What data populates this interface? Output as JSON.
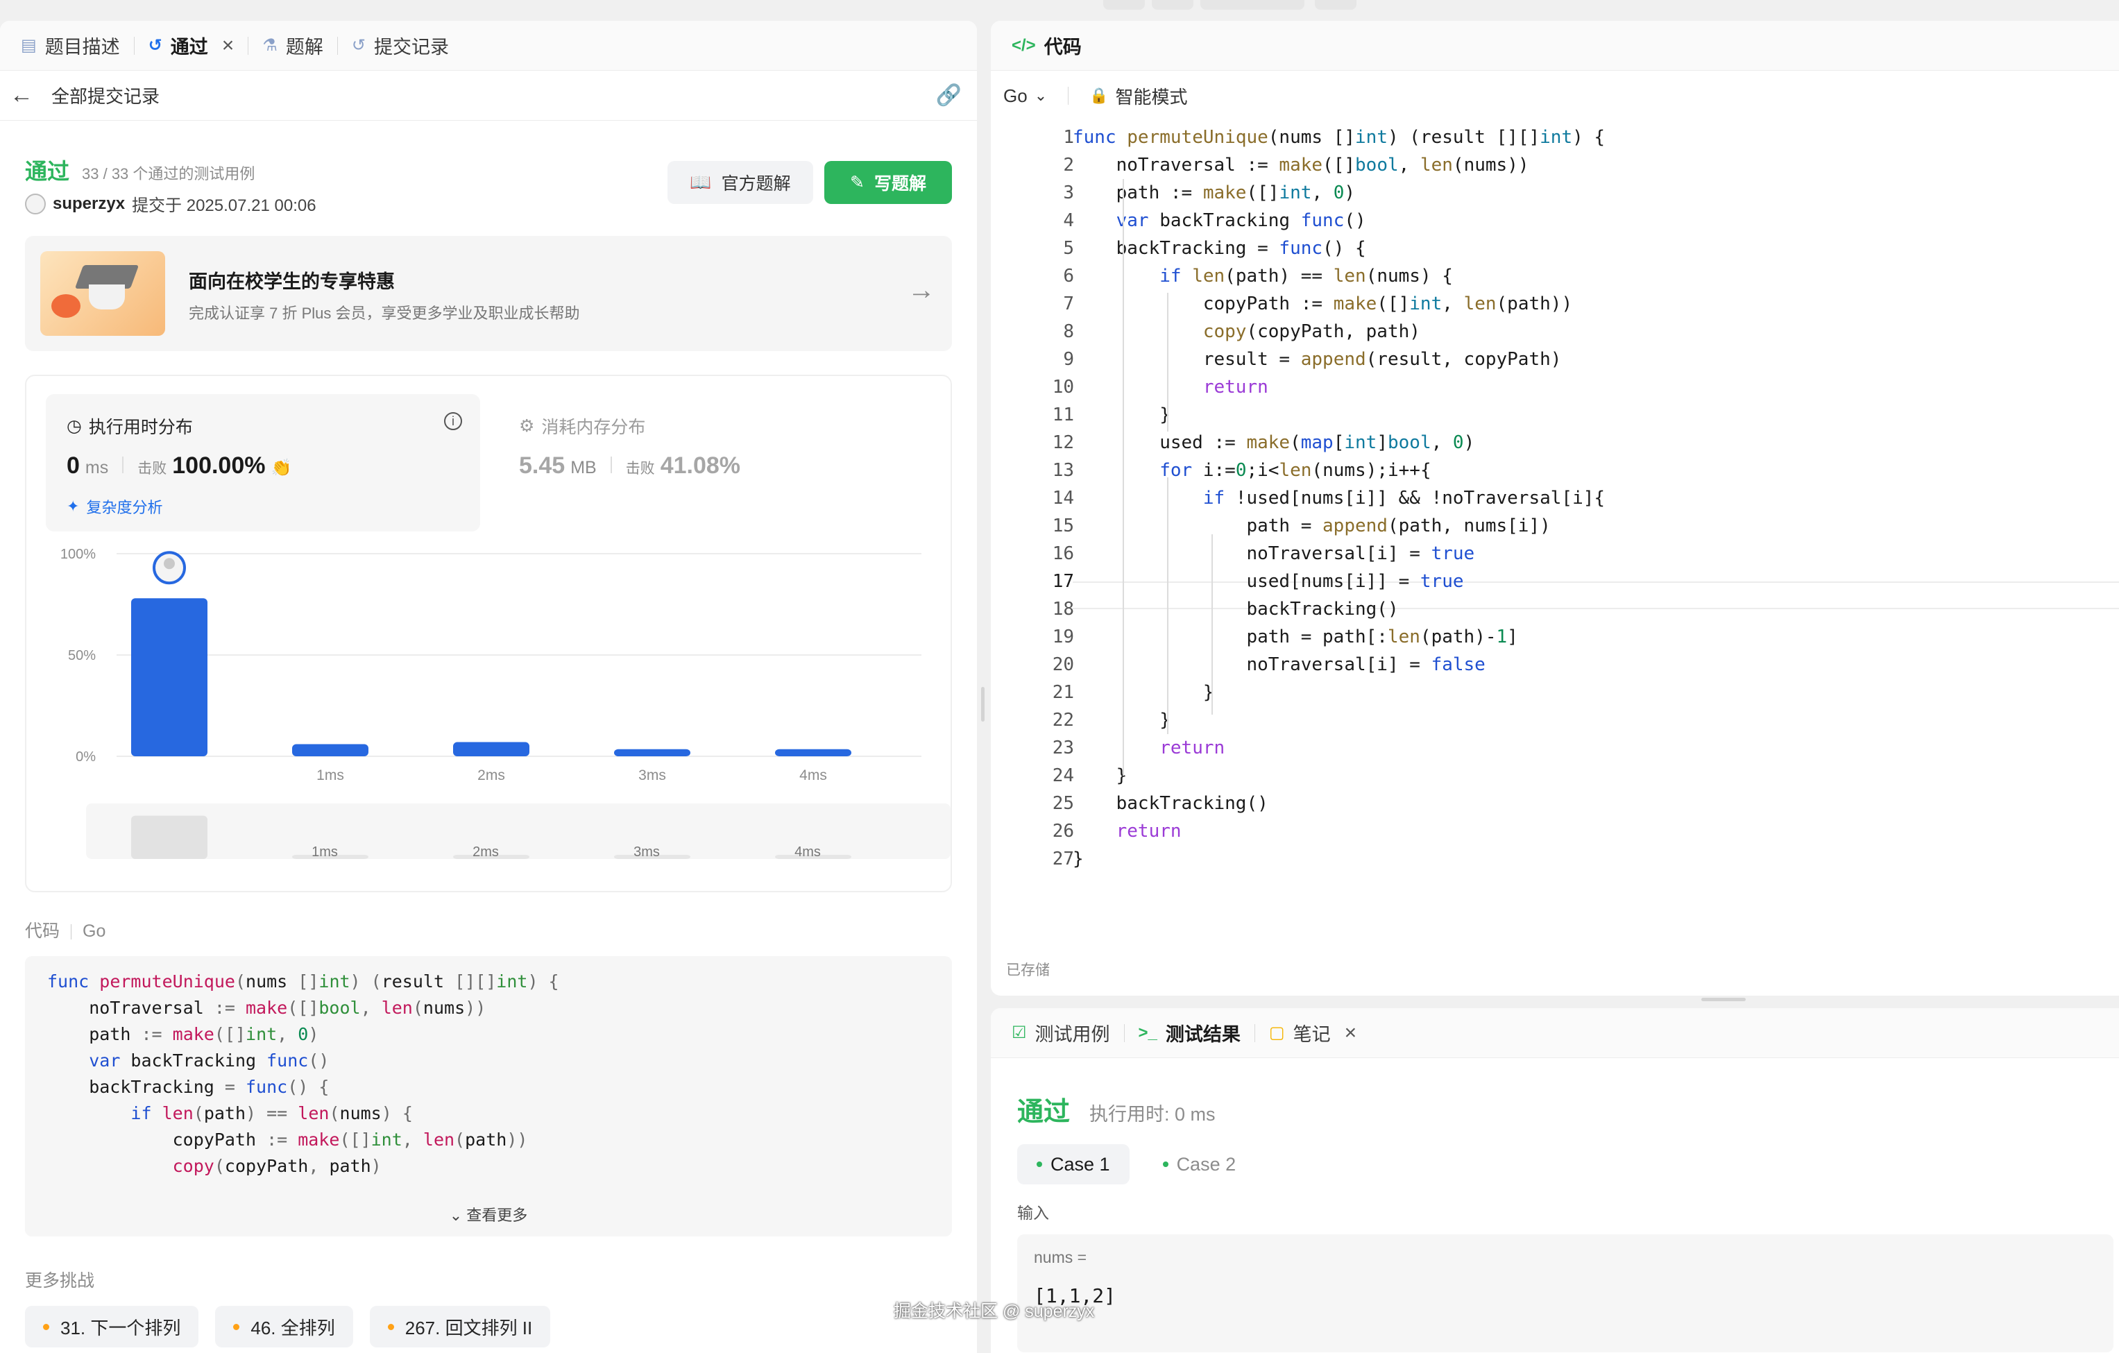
{
  "left_tabs": [
    {
      "label": "题目描述"
    },
    {
      "label": "通过"
    },
    {
      "label": "题解"
    },
    {
      "label": "提交记录"
    }
  ],
  "subbar": {
    "title": "全部提交记录"
  },
  "submission": {
    "status": "通过",
    "testcases": "33 / 33 个通过的测试用例",
    "user": "superzyx",
    "submitted": "提交于 2025.07.21 00:06"
  },
  "buttons": {
    "official": "官方题解",
    "write": "写题解"
  },
  "promo": {
    "title": "面向在校学生的专享特惠",
    "desc": "完成认证享 7 折 Plus 会员，享受更多学业及职业成长帮助"
  },
  "runtime": {
    "heading": "执行用时分布",
    "value": "0",
    "unit": "ms",
    "beat_label": "击败",
    "beat": "100.00%",
    "complexity": "复杂度分析"
  },
  "memory": {
    "heading": "消耗内存分布",
    "value": "5.45",
    "unit": "MB",
    "beat_label": "击败",
    "beat": "41.08%"
  },
  "chart_data": {
    "type": "bar",
    "categories": [
      "0ms",
      "1ms",
      "2ms",
      "3ms",
      "4ms"
    ],
    "tick_labels": [
      "",
      "1ms",
      "2ms",
      "3ms",
      "4ms"
    ],
    "values": [
      78,
      6,
      7,
      3.5,
      3.5
    ],
    "ylim": [
      0,
      100
    ],
    "yticks": [
      "100%",
      "50%",
      "0%"
    ],
    "grid": true,
    "highlight_index": 0,
    "accent": "#2768e0"
  },
  "code_section": {
    "label": "代码",
    "lang": "Go",
    "more": "查看更多"
  },
  "more_challenges": {
    "label": "更多挑战",
    "items": [
      "31. 下一个排列",
      "46. 全排列",
      "267. 回文排列 II"
    ]
  },
  "editor": {
    "tab": "代码",
    "lang": "Go",
    "mode": "智能模式",
    "saved": "已存储",
    "current_line": 17
  },
  "code_lines": [
    "func permuteUnique(nums []int) (result [][]int) {",
    "    noTraversal := make([]bool, len(nums))",
    "    path := make([]int, 0)",
    "    var backTracking func()",
    "    backTracking = func() {",
    "        if len(path) == len(nums) {",
    "            copyPath := make([]int, len(path))",
    "            copy(copyPath, path)",
    "            result = append(result, copyPath)",
    "            return",
    "        }",
    "        used := make(map[int]bool, 0)",
    "        for i:=0;i<len(nums);i++{",
    "            if !used[nums[i]] && !noTraversal[i]{",
    "                path = append(path, nums[i])",
    "                noTraversal[i] = true",
    "                used[nums[i]] = true",
    "                backTracking()",
    "                path = path[:len(path)-1]",
    "                noTraversal[i] = false",
    "            }",
    "        }",
    "        return",
    "    }",
    "    backTracking()",
    "    return",
    "}"
  ],
  "preview_lines": [
    "func permuteUnique(nums []int) (result [][]int) {",
    "    noTraversal := make([]bool, len(nums))",
    "    path := make([]int, 0)",
    "    var backTracking func()",
    "    backTracking = func() {",
    "        if len(path) == len(nums) {",
    "            copyPath := make([]int, len(path))",
    "            copy(copyPath, path)"
  ],
  "bottom_tabs": [
    {
      "label": "测试用例"
    },
    {
      "label": "测试结果"
    },
    {
      "label": "笔记"
    }
  ],
  "test_result": {
    "status": "通过",
    "runtime": "执行用时: 0 ms",
    "cases": [
      "Case 1",
      "Case 2"
    ],
    "input_label": "输入",
    "param_name": "nums =",
    "param_value": "[1,1,2]"
  },
  "watermark": "掘金技术社区 @ superzyx"
}
